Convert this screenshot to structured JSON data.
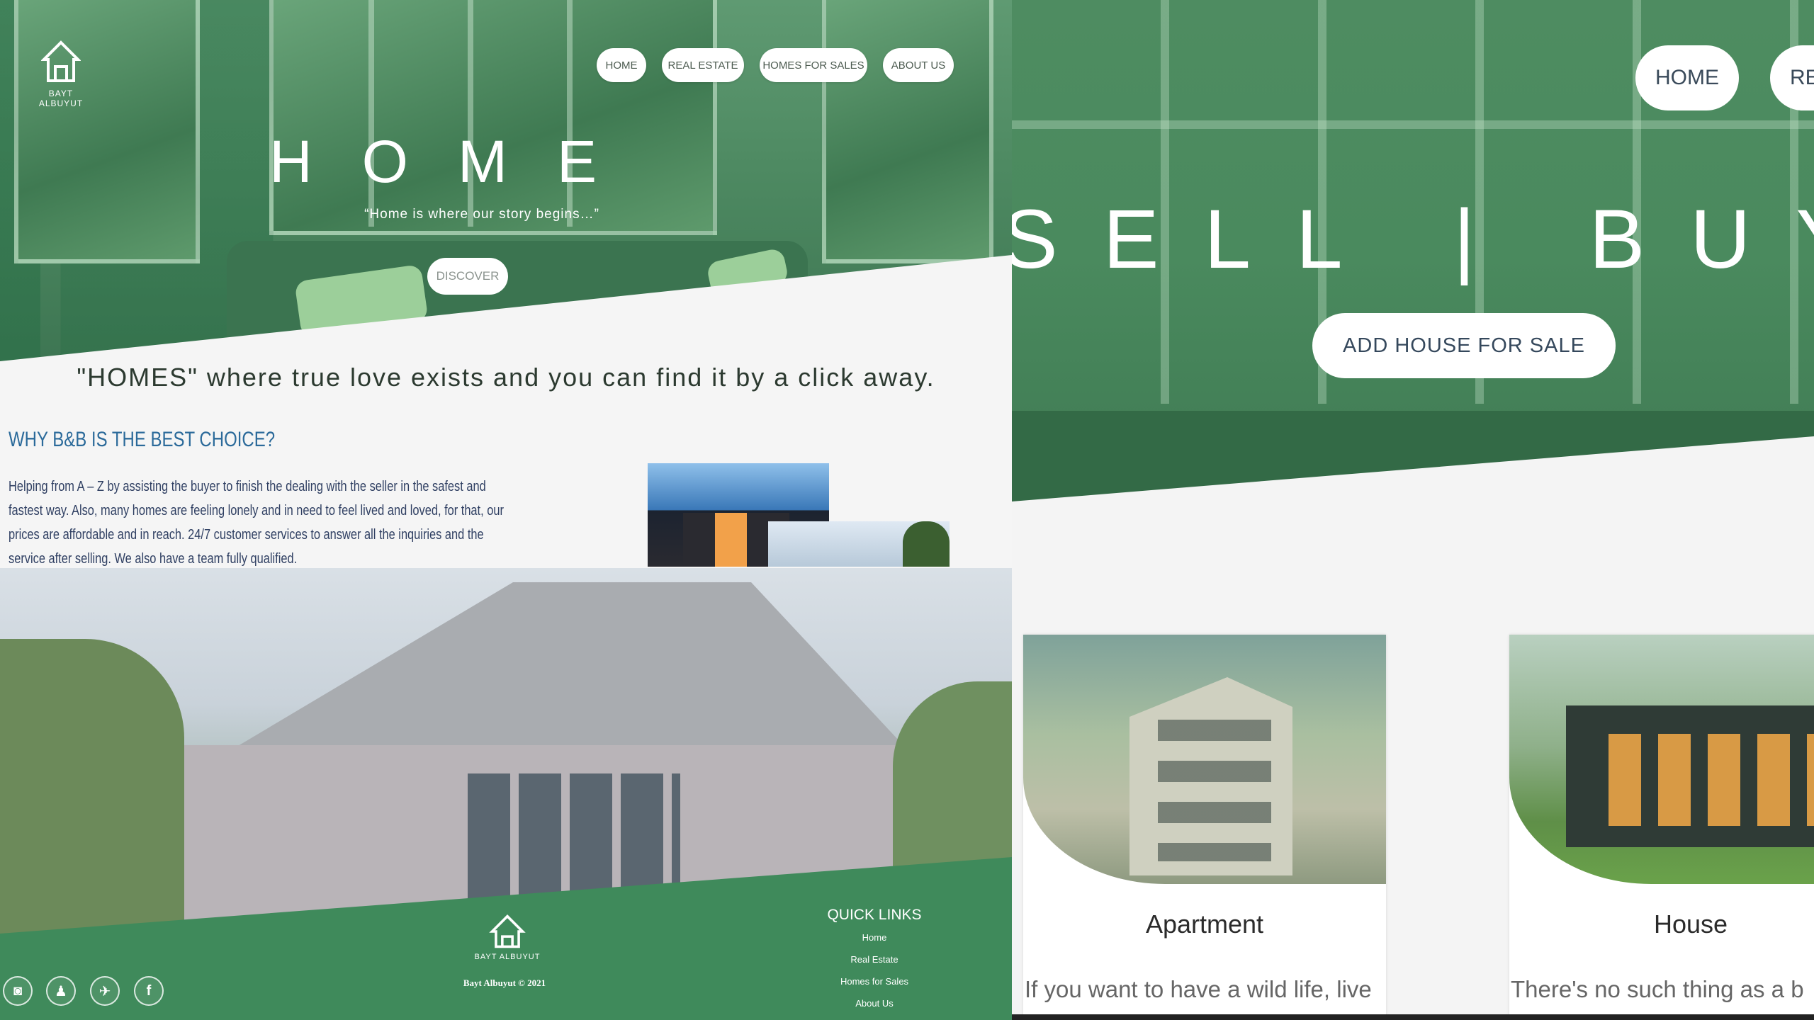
{
  "left": {
    "logo": {
      "text": "BAYT ALBUYUT"
    },
    "nav": [
      "HOME",
      "REAL ESTATE",
      "HOMES FOR SALES",
      "ABOUT US"
    ],
    "hero": {
      "title": "HOME",
      "subtitle": "“Home is where our story begins…”",
      "button": "DISCOVER"
    },
    "tagline": "\"HOMES\" where true love exists and you can find it by a click away.",
    "why": {
      "title": "WHY B&B IS THE BEST CHOICE?",
      "body": "Helping from A – Z by assisting the buyer to finish the dealing with the seller in the safest and fastest way. Also, many homes are feeling lonely and in need to feel lived and loved, for that, our prices are affordable and in reach. 24/7 customer services to answer all the inquiries and the service after selling. We also have a team fully qualified."
    },
    "footer": {
      "logo_text": "BAYT ALBUYUT",
      "copyright": "Bayt Albuyut © 2021",
      "quick_links_title": "QUICK LINKS",
      "quick_links": [
        "Home",
        "Real Estate",
        "Homes for Sales",
        "About Us"
      ],
      "social_icons": [
        "instagram-icon",
        "snapchat-icon",
        "twitter-icon",
        "facebook-icon"
      ]
    }
  },
  "right": {
    "nav": [
      "HOME",
      "RE"
    ],
    "hero": {
      "title": "SELL | BUY",
      "button": "ADD HOUSE FOR SALE"
    },
    "cards": [
      {
        "title": "Apartment",
        "text": "If you want to have a wild life, live"
      },
      {
        "title": "House",
        "text": "There's no such thing as a b"
      }
    ]
  },
  "colors": {
    "green": "#3f8a5b",
    "hero_green": "#4e8c61",
    "link_blue": "#2b6a9a"
  }
}
